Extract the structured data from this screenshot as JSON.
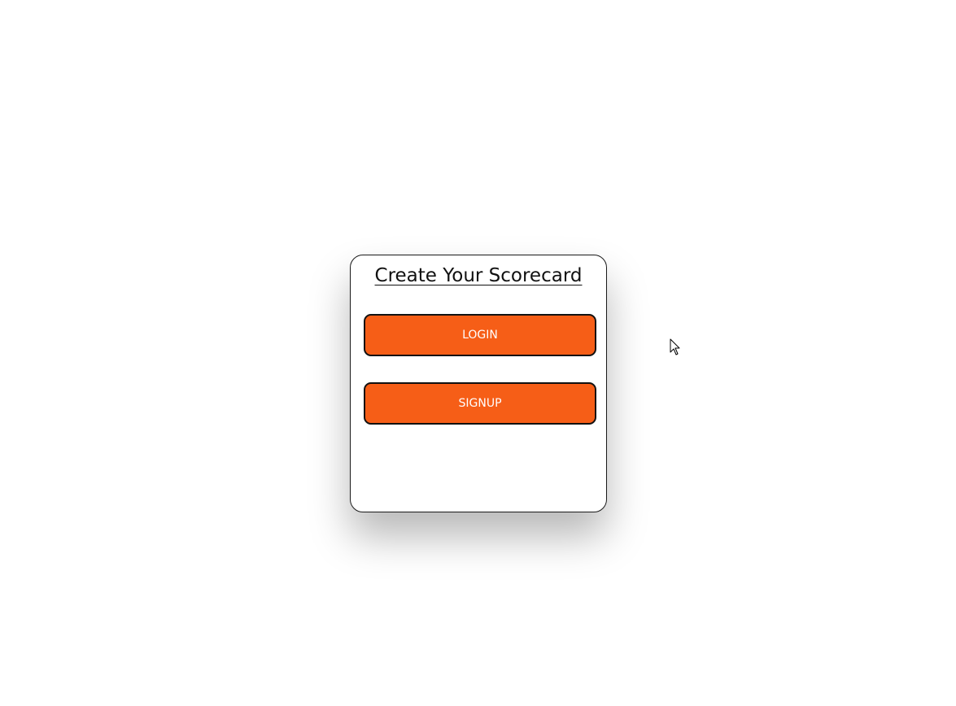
{
  "card": {
    "title": "Create Your Scorecard",
    "login_label": "LOGIN",
    "signup_label": "SIGNUP"
  },
  "colors": {
    "accent": "#f65e17",
    "border": "#111111"
  },
  "icons": {
    "cursor": "mouse-pointer-icon"
  }
}
